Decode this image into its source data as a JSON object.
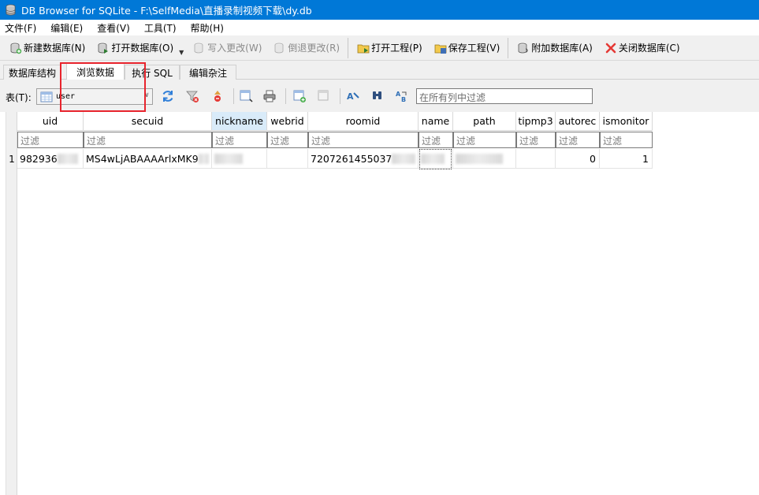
{
  "window": {
    "title": "DB Browser for SQLite - F:\\SelfMedia\\直播录制视频下载\\dy.db",
    "app_icon": "database-icon"
  },
  "menu": {
    "file": "文件(F)",
    "edit": "编辑(E)",
    "view": "查看(V)",
    "tools": "工具(T)",
    "help": "帮助(H)"
  },
  "toolbar": {
    "new_db": "新建数据库(N)",
    "open_db": "打开数据库(O)",
    "write_changes": "写入更改(W)",
    "revert_changes": "倒退更改(R)",
    "open_project": "打开工程(P)",
    "save_project": "保存工程(V)",
    "attach_db": "附加数据库(A)",
    "close_db": "关闭数据库(C)"
  },
  "tabs": {
    "structure": "数据库结构",
    "browse": "浏览数据",
    "execute_sql": "执行 SQL",
    "edit_pragmas": "编辑杂注"
  },
  "browse": {
    "table_label": "表(T):",
    "table_selected": "user",
    "global_filter_placeholder": "在所有列中过滤"
  },
  "grid": {
    "columns": [
      "uid",
      "secuid",
      "nickname",
      "webrid",
      "roomid",
      "name",
      "path",
      "tipmp3",
      "autorec",
      "ismonitor"
    ],
    "selected_column": "nickname",
    "filter_placeholder": "过滤",
    "rows": [
      {
        "rownum": "1",
        "uid": "982936",
        "secuid": "MS4wLjABAAAArlxMK9",
        "nickname": "",
        "webrid": "",
        "roomid": "7207261455037",
        "name": "",
        "path": "",
        "tipmp3": "",
        "autorec": "0",
        "ismonitor": "1"
      }
    ]
  },
  "colors": {
    "titlebar": "#0078d7",
    "highlight": "#e8242d",
    "selected_header": "#d9ebf9"
  }
}
